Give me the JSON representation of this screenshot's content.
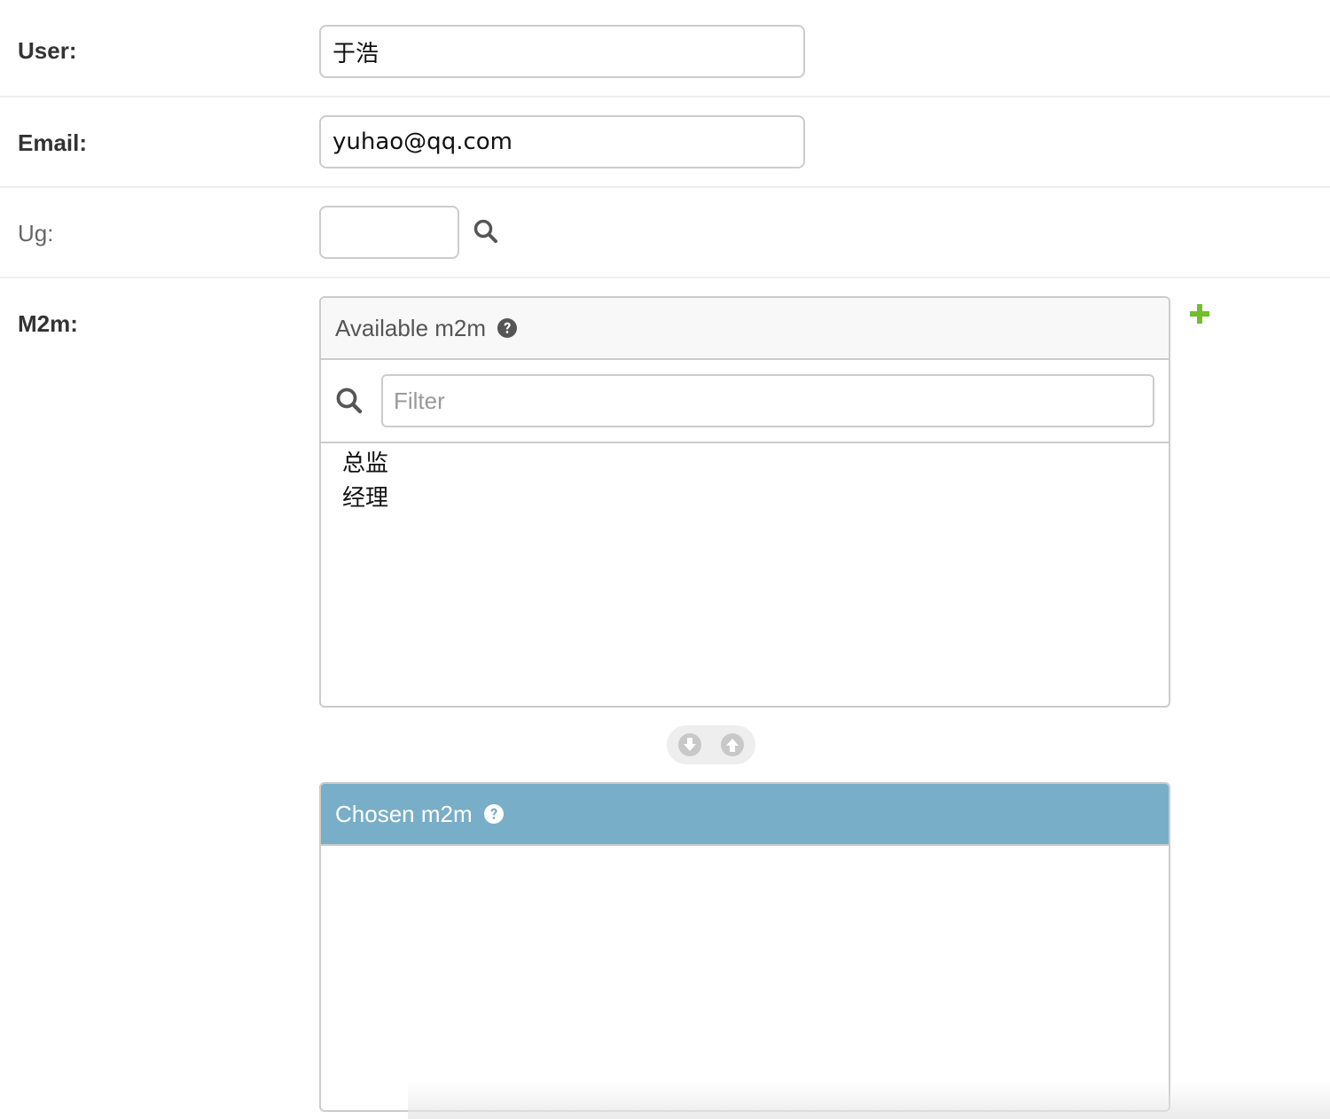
{
  "fields": {
    "user": {
      "label": "User:",
      "value": "于浩"
    },
    "email": {
      "label": "Email:",
      "value": "yuhao@qq.com"
    },
    "ug": {
      "label": "Ug:",
      "value": ""
    },
    "m2m": {
      "label": "M2m:"
    }
  },
  "available": {
    "title": "Available m2m",
    "filter_placeholder": "Filter",
    "options": [
      "总监",
      "经理"
    ]
  },
  "chosen": {
    "title": "Chosen m2m",
    "options": []
  },
  "colors": {
    "chosen_header": "#79aec8",
    "add_green": "#70bf2b",
    "border": "#cccccc"
  },
  "icons": {
    "lookup": "search-icon",
    "filter": "search-icon",
    "help": "help-icon",
    "add": "plus-icon",
    "choose": "arrow-down-circle-icon",
    "remove": "arrow-up-circle-icon"
  }
}
